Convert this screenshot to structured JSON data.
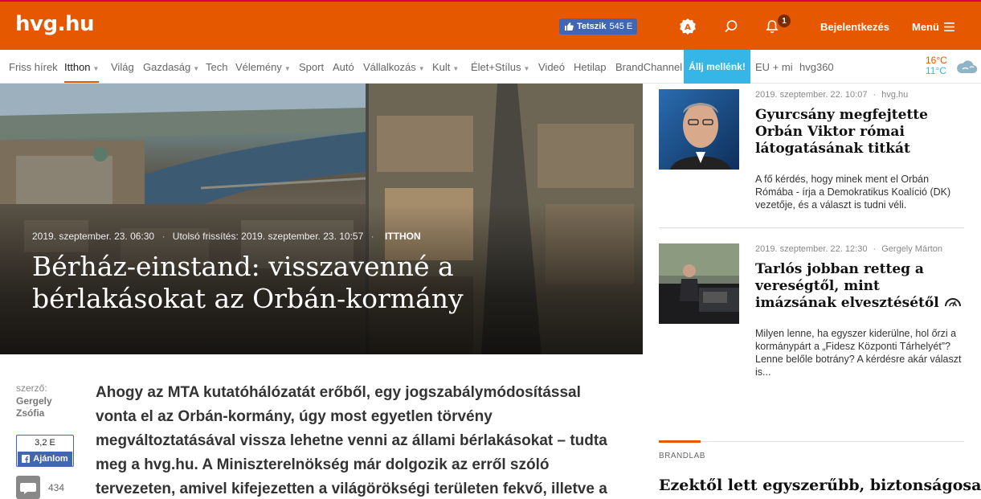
{
  "header": {
    "logo": "hvg.hu",
    "fb_like_label": "Tetszik",
    "fb_like_count": "545 E",
    "notification_count": "1",
    "login_label": "Bejelentkezés",
    "menu_label": "Menü",
    "accent_color": "#e55800"
  },
  "nav": {
    "items": [
      {
        "label": "Friss hírek"
      },
      {
        "label": "Itthon"
      },
      {
        "label": "Világ"
      },
      {
        "label": "Gazdaság"
      },
      {
        "label": "Tech"
      },
      {
        "label": "Vélemény"
      },
      {
        "label": "Sport"
      },
      {
        "label": "Autó"
      },
      {
        "label": "Vállalkozás"
      },
      {
        "label": "Kult"
      },
      {
        "label": "Élet+Stílus"
      },
      {
        "label": "Videó"
      },
      {
        "label": "Hetilap"
      },
      {
        "label": "BrandChannel"
      },
      {
        "label": "Állj mellénk!"
      },
      {
        "label": "EU + mi"
      },
      {
        "label": "hvg360"
      }
    ],
    "active": "Itthon"
  },
  "weather": {
    "high": "16°C",
    "low": "11°C",
    "icon": "cloud-icon"
  },
  "hero": {
    "date": "2019. szeptember. 23. 06:30",
    "updated": "Utolsó frissítés: 2019. szeptember. 23. 10:57",
    "category": "ITTHON",
    "title": "Bérház-einstand: visszavenné a bérlakásokat az Orbán-kormány"
  },
  "article": {
    "author_label": "szerző:",
    "author_name": "Gergely Zsófia",
    "share_count": "3,2 E",
    "share_label": "Ajánlom",
    "comment_count": "434",
    "lead": "Ahogy az MTA kutatóhálózatát erőből, egy jogszabálymódosítással vonta el az Orbán-kormány, úgy most egyetlen törvény megváltoztatásával vissza lehetne venni az állami bérlakásokat – tudta meg a hvg.hu. A Miniszterelnökség már dolgozik az erről szóló tervezeten, amivel kifejezetten a világörökségi területen fekvő, illetve a"
  },
  "sidebar": {
    "cards": [
      {
        "date": "2019. szeptember. 22. 10:07",
        "source": "hvg.hu",
        "title": "Gyurcsány megfejtette Orbán Viktor római látogatásának titkát",
        "excerpt": "A fő kérdés, hogy minek ment el Orbán Rómába - írja a Demokratikus Koalíció (DK) vezetője, és a választ is tudni véli."
      },
      {
        "date": "2019. szeptember. 22. 12:30",
        "source": "Gergely Márton",
        "title": "Tarlós jobban retteg a vereségtől, mint imázsának elvesztésétől",
        "excerpt": "Milyen lenne, ha egyszer kiderülne, hol őrzi a kormánypárt a „Fidesz Központi Tárhelyét”? Lenne belőle botrány? A kérdésre akár választ is..."
      }
    ],
    "brandlab_label": "BRANDLAB",
    "brandlab_title": "Ezektől lett egyszerűbb, biztonságosabb"
  }
}
